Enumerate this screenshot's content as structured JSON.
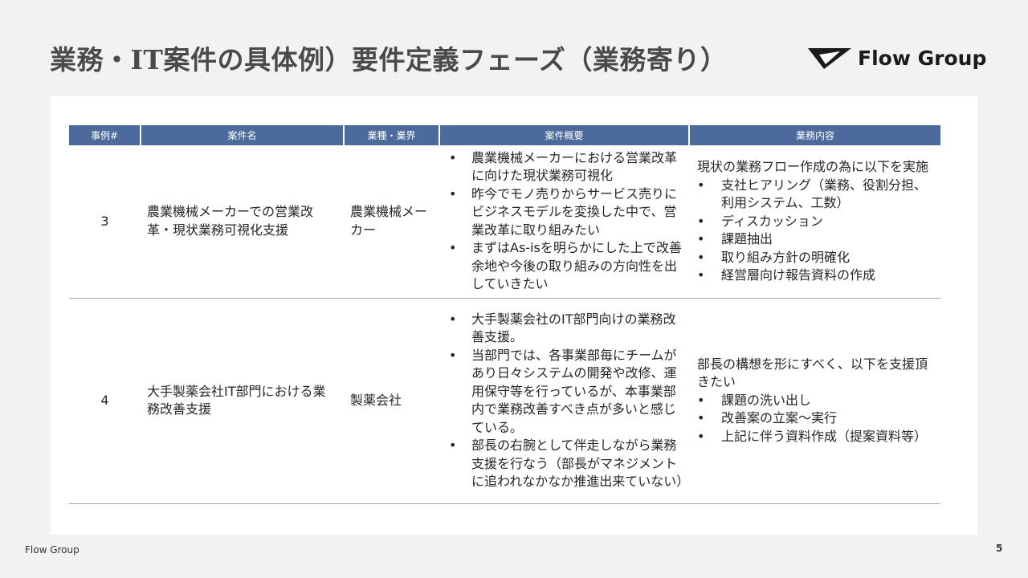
{
  "title": "業務・IT案件の具体例）要件定義フェーズ（業務寄り）",
  "logo": {
    "text": "Flow Group",
    "icon": "flow-group-logo-mark"
  },
  "table": {
    "headers": [
      "事例#",
      "案件名",
      "業種・業界",
      "案件概要",
      "業務内容"
    ],
    "rows": [
      {
        "id": "3",
        "name": "農業機械メーカーでの営業改革・現状業務可視化支援",
        "industry": "農業機械メーカー",
        "summary": [
          "農業機械メーカーにおける営業改革に向けた現状業務可視化",
          "昨今でモノ売りからサービス売りにビジネスモデルを変換した中で、営業改革に取り組みたい",
          "まずはAs-isを明らかにした上で改善余地や今後の取り組みの方向性を出していきたい"
        ],
        "content_intro": "現状の業務フロー作成の為に以下を実施",
        "content_items": [
          "支社ヒアリング（業務、役割分担、利用システム、工数）",
          "ディスカッション",
          "課題抽出",
          "取り組み方針の明確化",
          "経営層向け報告資料の作成"
        ]
      },
      {
        "id": "4",
        "name": "大手製薬会社IT部門における業務改善支援",
        "industry": "製薬会社",
        "summary": [
          "大手製薬会社のIT部門向けの業務改善支援。",
          "当部門では、各事業部毎にチームがあり日々システムの開発や改修、運用保守等を行っているが、本事業部内で業務改善すべき点が多いと感じている。",
          "部長の右腕として伴走しながら業務支援を行なう（部長がマネジメントに追われなかなか推進出来ていない）"
        ],
        "content_intro": "部長の構想を形にすべく、以下を支援頂きたい",
        "content_items": [
          "課題の洗い出し",
          "改善案の立案～実行",
          "上記に伴う資料作成（提案資料等）"
        ]
      }
    ]
  },
  "footer": {
    "company": "Flow Group",
    "page": "5"
  }
}
